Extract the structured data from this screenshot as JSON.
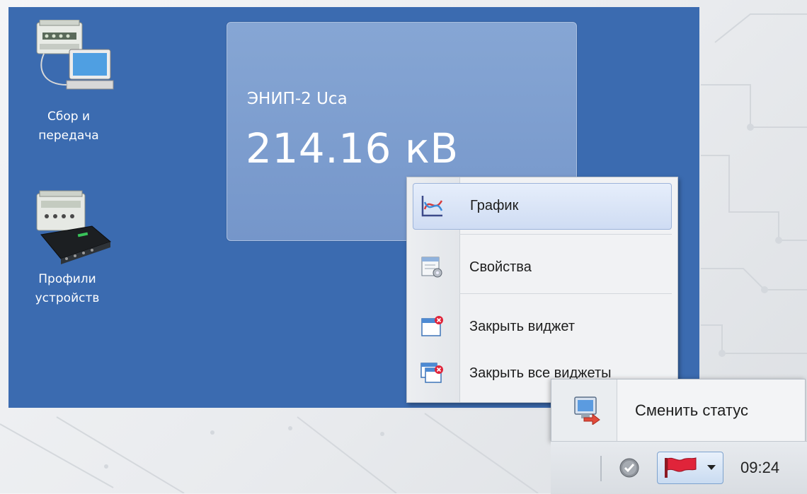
{
  "desktop": {
    "icons": [
      {
        "label_line1": "Сбор и",
        "label_line2": "передача",
        "icon": "data-collection-icon"
      },
      {
        "label_line1": "Профили",
        "label_line2": "устройств",
        "icon": "device-profiles-icon"
      }
    ]
  },
  "widget": {
    "title": "ЭНИП-2 Uca",
    "value": "214.16 кВ"
  },
  "context_menu": {
    "items": [
      {
        "label": "График",
        "icon": "chart-icon"
      },
      {
        "label": "Свойства",
        "icon": "properties-icon"
      },
      {
        "label": "Закрыть виджет",
        "icon": "close-widget-icon"
      },
      {
        "label": "Закрыть все виджеты",
        "icon": "close-all-widgets-icon"
      }
    ]
  },
  "status_popup": {
    "label": "Сменить статус",
    "icon": "change-status-icon"
  },
  "taskbar": {
    "clock": "09:24",
    "status_icon": "check-circle-icon",
    "flag_icon": "red-flag-icon"
  },
  "colors": {
    "desktop_bg": "#3b6bb0",
    "widget_bg": "#7f9fd0",
    "menu_bg": "#f1f2f4",
    "accent_red": "#e0243a"
  }
}
